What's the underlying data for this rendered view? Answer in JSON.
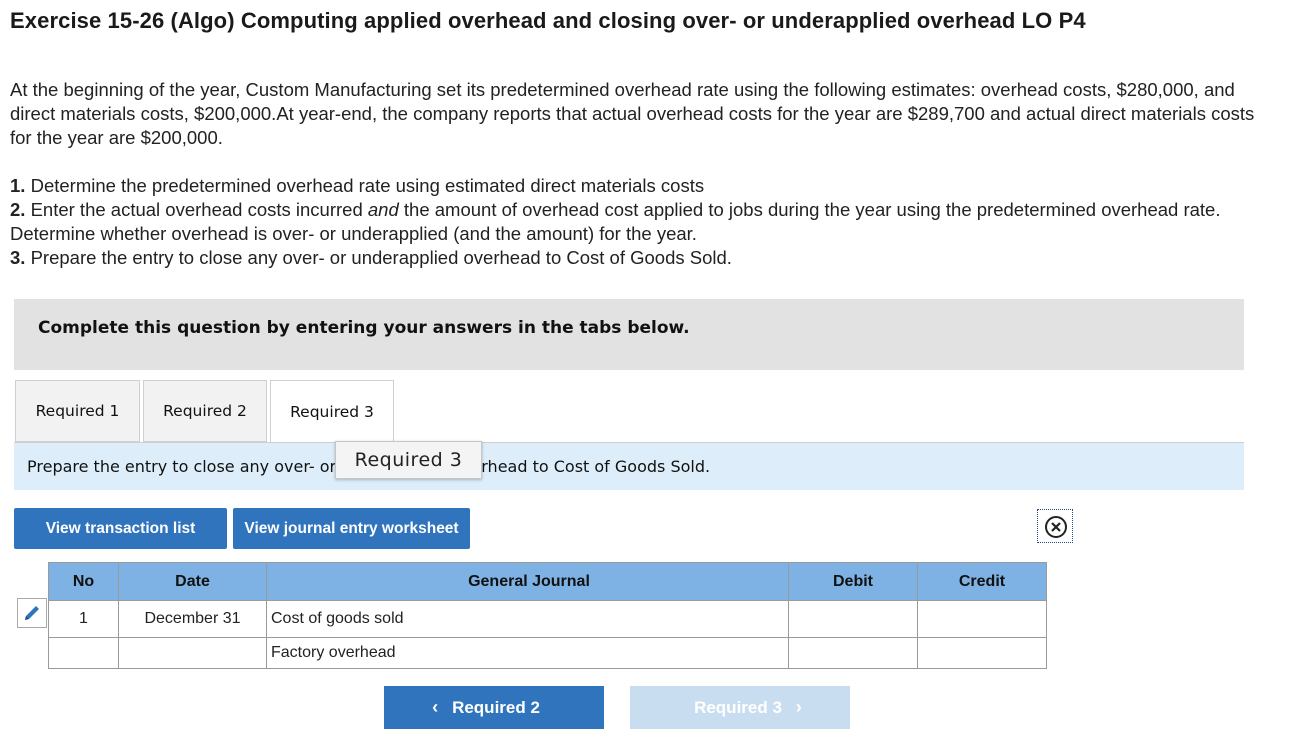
{
  "title": "Exercise 15-26 (Algo) Computing applied overhead and closing over- or underapplied overhead LO P4",
  "intro": "At the beginning of the year, Custom Manufacturing set its predetermined overhead rate using the following estimates: overhead costs, $280,000, and direct materials costs, $200,000.At year-end, the company reports that actual overhead costs for the year are $289,700 and actual direct materials costs for the year are $200,000.",
  "steps": [
    {
      "num": "1.",
      "text": " Determine the predetermined overhead rate using estimated direct materials costs"
    },
    {
      "num": "2.",
      "text_a": " Enter the actual overhead costs incurred ",
      "em": "and",
      "text_b": " the amount of overhead cost applied to jobs during the year using the predetermined overhead rate. Determine whether overhead is over- or underapplied (and the amount) for the year."
    },
    {
      "num": "3.",
      "text": " Prepare the entry to close any over- or underapplied overhead to Cost of Goods Sold."
    }
  ],
  "banner": "Complete this question by entering your answers in the tabs below.",
  "tabs": [
    "Required 1",
    "Required 2",
    "Required 3"
  ],
  "active_tab": 2,
  "instruction": "Prepare the entry to close any over- or underapplied overhead to Cost of Goods Sold.",
  "tooltip": "Required 3",
  "buttons": {
    "transaction_list": "View transaction list",
    "journal_worksheet": "View journal entry worksheet"
  },
  "journal": {
    "headers": [
      "No",
      "Date",
      "General Journal",
      "Debit",
      "Credit"
    ],
    "rows": [
      {
        "no": "1",
        "date": "December 31",
        "account": "Cost of goods sold",
        "debit": "",
        "credit": ""
      },
      {
        "no": "",
        "date": "",
        "account": "Factory overhead",
        "debit": "",
        "credit": ""
      }
    ]
  },
  "nav": {
    "prev": "Required 2",
    "next": "Required 3"
  },
  "colors": {
    "primary": "#2f74bc",
    "header": "#7eb2e4",
    "instruction_bg": "#ddeefa",
    "disabled": "#c9ddf1"
  },
  "icons": {
    "edit": "pencil-icon",
    "close": "close-circle-icon",
    "prev": "chevron-left-icon",
    "next": "chevron-right-icon"
  }
}
